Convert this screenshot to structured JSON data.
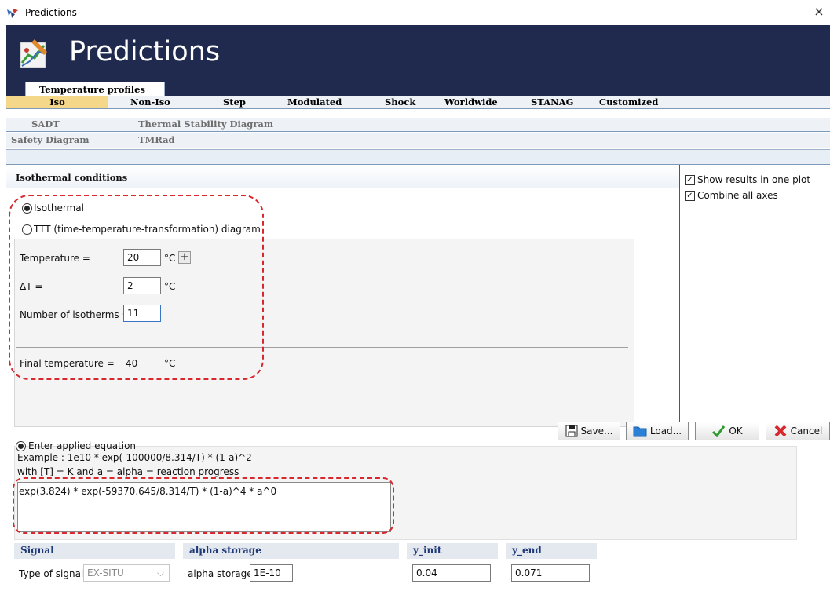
{
  "window": {
    "title": "Predictions",
    "close_glyph": "×"
  },
  "banner": {
    "title": "Predictions"
  },
  "tabs": {
    "main": "Temperature profiles"
  },
  "menu": {
    "row1": [
      "Iso",
      "Non-Iso",
      "Step",
      "Modulated",
      "Shock",
      "Worldwide",
      "STANAG",
      "Customized"
    ],
    "row2": [
      "SADT",
      "Thermal Stability Diagram"
    ],
    "row3": [
      "Safety Diagram",
      "TMRad"
    ],
    "selected": "Iso"
  },
  "iso": {
    "section_title": "Isothermal conditions",
    "radio_isothermal": "Isothermal",
    "radio_ttt": "TTT (time-temperature-transformation) diagram",
    "temperature_label": "Temperature =",
    "temperature_value": "20",
    "temperature_unit": "°C",
    "plus": "+",
    "delta_label": "ΔT =",
    "delta_value": "2",
    "delta_unit": "°C",
    "isotherms_label": "Number of isotherms =",
    "isotherms_value": "11",
    "final_label": "Final temperature =",
    "final_value": "40",
    "final_unit": "°C"
  },
  "options": {
    "show_results_one_plot": "Show results in one plot",
    "combine_all_axes": "Combine all axes",
    "show_checked": true,
    "combine_checked": true
  },
  "buttons": {
    "save": "Save...",
    "load": "Load...",
    "ok": "OK",
    "cancel": "Cancel"
  },
  "equation": {
    "radio_label": "Enter applied equation",
    "example_line": "Example :  1e10 * exp(-100000/8.314/T) * (1-a)^2",
    "with_line": "with [T] = K and a = alpha = reaction progress",
    "value": "exp(3.824) * exp(-59370.645/8.314/T) * (1-a)^4 * a^0"
  },
  "bottom": {
    "signal_head": "Signal",
    "signal_label": "Type of signal",
    "signal_value": "EX-SITU",
    "alpha_head": "alpha storage",
    "alpha_label": "alpha storage",
    "alpha_value": "1E-10",
    "yinit_head": "y_init",
    "yinit_value": "0.04",
    "yend_head": "y_end",
    "yend_value": "0.071"
  },
  "colors": {
    "banner": "#1f2a4e",
    "selected_tab": "#f4d788",
    "highlight": "#d9272e",
    "ok_check": "#2e9b2e",
    "cancel_x": "#d9272e",
    "head_text": "#1f3a78"
  }
}
